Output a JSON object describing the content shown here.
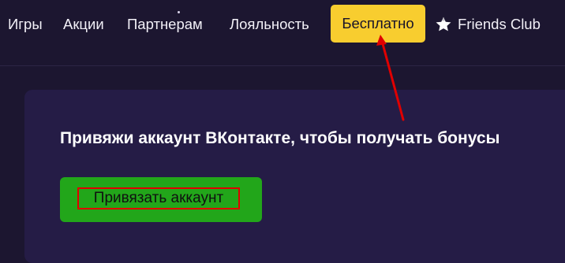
{
  "nav": {
    "games": "Игры",
    "promotions": "Акции",
    "partners": "Партнерам",
    "loyalty": "Лояльность",
    "free": "Бесплатно",
    "friends_club": "Friends Club",
    "friends_club_icon": "star-icon"
  },
  "panel": {
    "title": "Привяжи аккаунт ВКонтакте, чтобы получать бонусы",
    "button_label": "Привязать аккаунт"
  },
  "colors": {
    "background": "#1c1630",
    "panel": "#251c46",
    "free_button": "#f8cd2f",
    "link_button": "#22a61a",
    "annotation": "#e00000"
  }
}
